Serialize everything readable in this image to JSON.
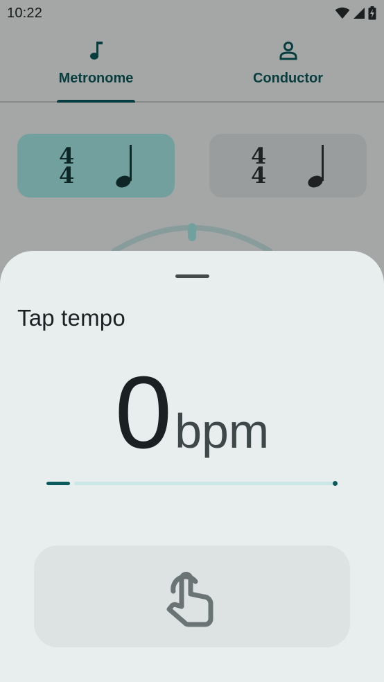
{
  "status_bar": {
    "time": "10:22",
    "icons": [
      "wifi-icon",
      "cellular-signal-icon",
      "battery-charging-icon"
    ]
  },
  "tabs": [
    {
      "label": "Metronome",
      "icon": "music-note-icon",
      "selected": true
    },
    {
      "label": "Conductor",
      "icon": "person-icon",
      "selected": false
    }
  ],
  "beat_cards": [
    {
      "time_signature_top": "4",
      "time_signature_bottom": "4",
      "note": "quarter-note-icon",
      "selected": true
    },
    {
      "time_signature_top": "4",
      "time_signature_bottom": "4",
      "note": "quarter-note-icon",
      "selected": false
    }
  ],
  "sheet": {
    "title": "Tap tempo",
    "bpm_value": "0",
    "bpm_unit": "bpm",
    "tap_button_icon": "touch-tap-icon",
    "progress_fraction": 0.08
  },
  "colors": {
    "primary": "#0b5a5c",
    "selected_card": "#a9ece9",
    "sheet_background": "#e8eeee",
    "tap_button": "#dde3e3",
    "progress_track": "#cbe6e6"
  }
}
